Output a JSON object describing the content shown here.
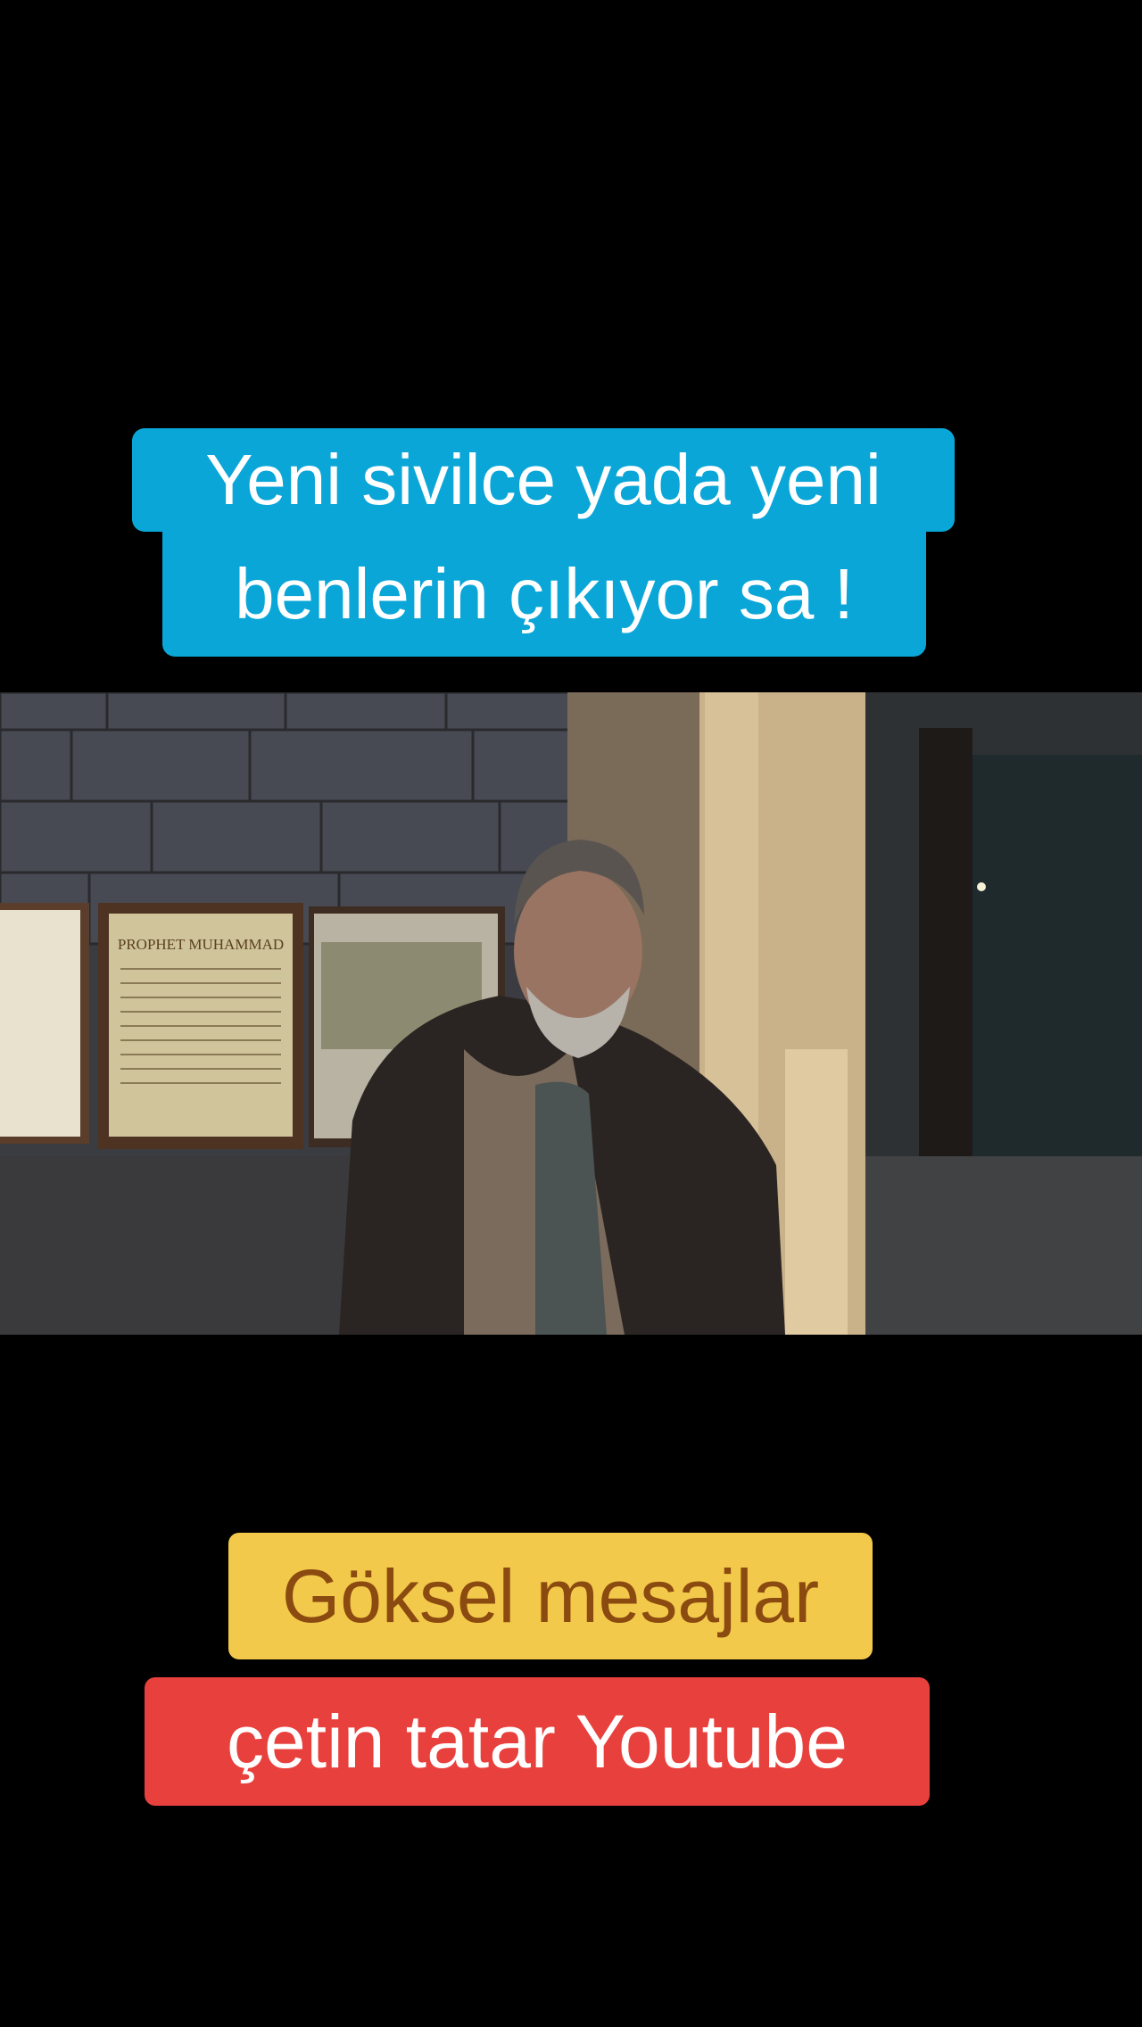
{
  "captions": {
    "top_line1": "Yeni sivilce yada yeni",
    "top_line2": "benlerin çıkıyor sa !",
    "yellow": "Göksel mesajlar",
    "red": "çetin tatar Youtube "
  },
  "video": {
    "poster_title": "PROPHET MUHAMMAD"
  },
  "colors": {
    "caption_blue": "#0aa6d8",
    "sticker_yellow": "#f2c94a",
    "sticker_yellow_text": "#8a4a10",
    "sticker_red": "#e8403c",
    "background": "#000000"
  }
}
